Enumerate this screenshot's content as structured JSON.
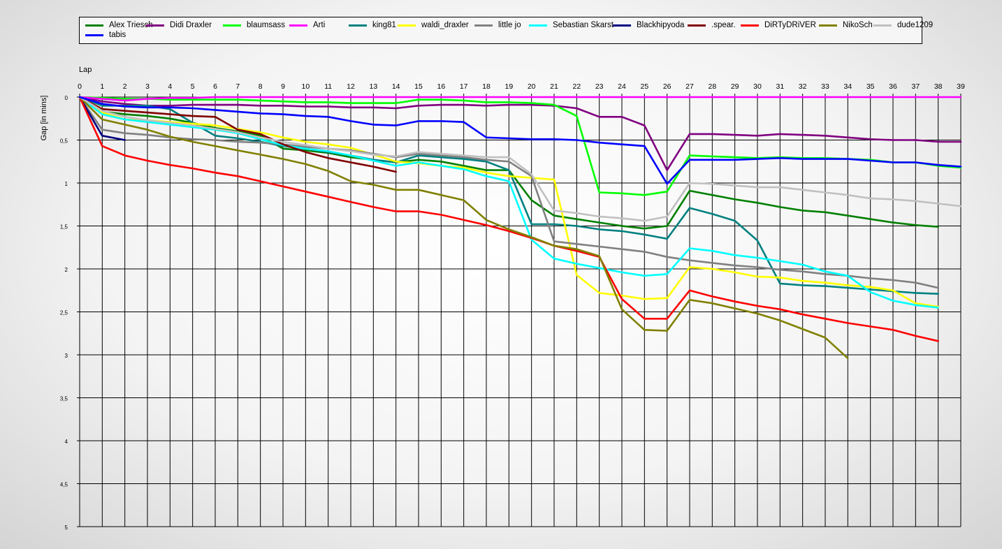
{
  "chart_data": {
    "type": "line",
    "xlabel": "Lap",
    "ylabel": "Gap [in mins]",
    "xlim": [
      0,
      39
    ],
    "ylim": [
      0,
      5
    ],
    "y_inverted": true,
    "x_ticks": [
      0,
      1,
      2,
      3,
      4,
      5,
      6,
      7,
      8,
      9,
      10,
      11,
      12,
      13,
      14,
      15,
      16,
      17,
      18,
      19,
      20,
      21,
      22,
      23,
      24,
      25,
      26,
      27,
      28,
      29,
      30,
      31,
      32,
      33,
      34,
      35,
      36,
      37,
      38,
      39
    ],
    "y_ticks": [
      "0",
      "0,5",
      "1",
      "1,5",
      "2",
      "2,5",
      "3",
      "3,5",
      "4",
      "4,5",
      "5"
    ],
    "grid": true,
    "legend_position": "top",
    "series": [
      {
        "name": "Alex Triesch",
        "color": "#008000",
        "values": [
          0,
          0.17,
          0.2,
          0.22,
          0.25,
          0.3,
          0.36,
          0.4,
          0.45,
          0.6,
          0.62,
          0.65,
          0.7,
          0.73,
          0.76,
          0.73,
          0.75,
          0.8,
          0.85,
          0.85,
          1.2,
          1.38,
          1.42,
          1.46,
          1.5,
          1.53,
          1.5,
          1.09,
          1.14,
          1.19,
          1.23,
          1.28,
          1.32,
          1.34,
          1.38,
          1.42,
          1.46,
          1.49,
          1.51
        ]
      },
      {
        "name": "Didi Draxler",
        "color": "#800080",
        "values": [
          0,
          0.05,
          0.08,
          0.1,
          0.1,
          0.09,
          0.09,
          0.09,
          0.1,
          0.1,
          0.11,
          0.11,
          0.12,
          0.12,
          0.13,
          0.1,
          0.09,
          0.09,
          0.1,
          0.09,
          0.09,
          0.1,
          0.13,
          0.23,
          0.23,
          0.33,
          0.85,
          0.43,
          0.43,
          0.44,
          0.45,
          0.43,
          0.44,
          0.45,
          0.47,
          0.49,
          0.5,
          0.5,
          0.52,
          0.52
        ]
      },
      {
        "name": "blaumsass",
        "color": "#00ff00",
        "values": [
          0,
          0.01,
          0.02,
          0.02,
          0.03,
          0.03,
          0.03,
          0.03,
          0.04,
          0.05,
          0.06,
          0.06,
          0.07,
          0.07,
          0.07,
          0.03,
          0.03,
          0.04,
          0.06,
          0.06,
          0.07,
          0.09,
          0.22,
          1.11,
          1.12,
          1.14,
          1.1,
          0.68,
          0.69,
          0.7,
          0.71,
          0.7,
          0.71,
          0.71,
          0.72,
          0.73,
          0.76,
          0.76,
          0.8,
          0.82
        ]
      },
      {
        "name": "Arti",
        "color": "#ff00ff",
        "values": [
          0,
          0.02,
          0.04,
          0.02,
          0.01,
          0.01,
          0,
          0,
          0,
          0,
          0,
          0,
          0,
          0,
          0,
          0,
          0,
          0,
          0,
          0,
          0,
          0,
          0,
          0,
          0,
          0,
          0,
          0,
          0,
          0,
          0,
          0,
          0,
          0,
          0,
          0,
          0,
          0,
          0,
          0
        ]
      },
      {
        "name": "king81",
        "color": "#008080",
        "values": [
          0,
          0.1,
          0.1,
          0.1,
          0.14,
          0.3,
          0.45,
          0.48,
          0.52,
          0.57,
          0.6,
          0.64,
          0.68,
          0.73,
          0.76,
          0.68,
          0.7,
          0.72,
          0.75,
          0.85,
          1.48,
          1.48,
          1.5,
          1.54,
          1.56,
          1.6,
          1.65,
          1.29,
          1.36,
          1.44,
          1.67,
          2.17,
          2.19,
          2.2,
          2.22,
          2.24,
          2.26,
          2.28,
          2.29
        ]
      },
      {
        "name": "waldi_draxler",
        "color": "#ffff00",
        "values": [
          0,
          0.18,
          0.26,
          0.27,
          0.29,
          0.31,
          0.33,
          0.37,
          0.41,
          0.47,
          0.52,
          0.55,
          0.59,
          0.67,
          0.75,
          0.77,
          0.8,
          0.82,
          0.88,
          0.92,
          0.94,
          0.96,
          2.07,
          2.28,
          2.31,
          2.35,
          2.34,
          1.98,
          2,
          2.04,
          2.09,
          2.1,
          2.14,
          2.16,
          2.19,
          2.21,
          2.25,
          2.4,
          2.44
        ]
      },
      {
        "name": "little jo",
        "color": "#808080",
        "values": [
          0,
          0.38,
          0.42,
          0.44,
          0.47,
          0.49,
          0.5,
          0.52,
          0.53,
          0.55,
          0.58,
          0.6,
          0.62,
          0.66,
          0.7,
          0.66,
          0.68,
          0.7,
          0.73,
          0.75,
          0.92,
          1.68,
          1.71,
          1.74,
          1.77,
          1.8,
          1.86,
          1.9,
          1.93,
          1.96,
          1.98,
          2.01,
          2.03,
          2.06,
          2.08,
          2.11,
          2.13,
          2.16,
          2.22
        ]
      },
      {
        "name": "Sebastian Skarst",
        "color": "#00ffff",
        "values": [
          0,
          0.2,
          0.26,
          0.29,
          0.32,
          0.35,
          0.38,
          0.42,
          0.49,
          0.56,
          0.6,
          0.63,
          0.68,
          0.74,
          0.8,
          0.76,
          0.8,
          0.84,
          0.92,
          0.98,
          1.66,
          1.88,
          1.94,
          1.99,
          2.04,
          2.08,
          2.06,
          1.76,
          1.79,
          1.84,
          1.87,
          1.91,
          1.95,
          2.03,
          2.08,
          2.27,
          2.37,
          2.42,
          2.45
        ]
      },
      {
        "name": "Blackhipyoda",
        "color": "#000080",
        "values": [
          0,
          0.45,
          0.5
        ]
      },
      {
        "name": ".spear.",
        "color": "#800000",
        "values": [
          0,
          0.14,
          0.16,
          0.18,
          0.2,
          0.22,
          0.23,
          0.38,
          0.43,
          0.55,
          0.64,
          0.71,
          0.76,
          0.81,
          0.87
        ]
      },
      {
        "name": "DiRTyDRiVER",
        "color": "#ff0000",
        "values": [
          0,
          0.57,
          0.68,
          0.74,
          0.79,
          0.83,
          0.88,
          0.92,
          0.98,
          1.04,
          1.1,
          1.16,
          1.22,
          1.28,
          1.33,
          1.33,
          1.37,
          1.43,
          1.49,
          1.56,
          1.64,
          1.73,
          1.79,
          1.86,
          2.35,
          2.58,
          2.58,
          2.25,
          2.32,
          2.38,
          2.43,
          2.47,
          2.53,
          2.58,
          2.63,
          2.67,
          2.71,
          2.78,
          2.84
        ]
      },
      {
        "name": "NikoSch",
        "color": "#808000",
        "values": [
          0,
          0.26,
          0.32,
          0.38,
          0.46,
          0.52,
          0.57,
          0.62,
          0.67,
          0.72,
          0.78,
          0.86,
          0.98,
          1.02,
          1.08,
          1.08,
          1.14,
          1.2,
          1.43,
          1.54,
          1.63,
          1.73,
          1.77,
          1.85,
          2.47,
          2.71,
          2.72,
          2.36,
          2.4,
          2.46,
          2.52,
          2.6,
          2.7,
          2.8,
          3.04
        ]
      },
      {
        "name": "dude1209",
        "color": "#c0c0c0",
        "values": [
          0,
          0.16,
          0.23,
          0.27,
          0.3,
          0.33,
          0.37,
          0.41,
          0.47,
          0.52,
          0.56,
          0.6,
          0.63,
          0.67,
          0.69,
          0.64,
          0.66,
          0.68,
          0.7,
          0.7,
          0.9,
          1.32,
          1.35,
          1.39,
          1.41,
          1.44,
          1.39,
          1,
          1.01,
          1.03,
          1.05,
          1.05,
          1.08,
          1.11,
          1.14,
          1.18,
          1.19,
          1.21,
          1.24,
          1.27
        ]
      },
      {
        "name": "tabis",
        "color": "#0000ff",
        "values": [
          0,
          0.08,
          0.11,
          0.12,
          0.12,
          0.13,
          0.15,
          0.17,
          0.19,
          0.2,
          0.22,
          0.23,
          0.28,
          0.32,
          0.33,
          0.28,
          0.28,
          0.29,
          0.47,
          0.48,
          0.49,
          0.49,
          0.5,
          0.53,
          0.55,
          0.57,
          1.01,
          0.73,
          0.73,
          0.73,
          0.72,
          0.71,
          0.72,
          0.72,
          0.72,
          0.74,
          0.76,
          0.76,
          0.79,
          0.81
        ]
      }
    ]
  }
}
